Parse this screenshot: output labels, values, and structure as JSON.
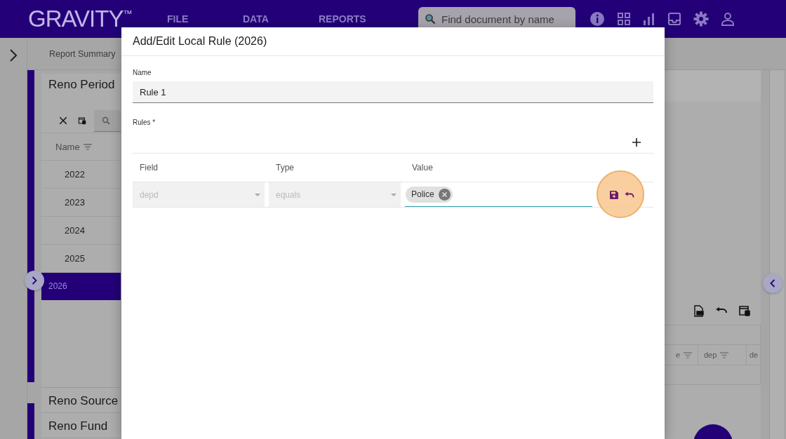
{
  "app": {
    "logo": "GRAVITY",
    "logo_mark": "™",
    "menu": [
      {
        "label": "FILE"
      },
      {
        "label": "DATA"
      },
      {
        "label": "REPORTS"
      }
    ],
    "search": {
      "placeholder": "Find document by name"
    }
  },
  "breadcrumb": "Report Summary",
  "left_panel": {
    "title": "Reno Period",
    "column": "Name",
    "rows": [
      {
        "label": "2022",
        "selected": false
      },
      {
        "label": "2023",
        "selected": false
      },
      {
        "label": "2024",
        "selected": false
      },
      {
        "label": "2025",
        "selected": false
      },
      {
        "label": "2026",
        "selected": true
      }
    ],
    "sections": [
      "Reno Source",
      "Reno Fund"
    ]
  },
  "right_panel": {
    "columns": [
      "e",
      "dep",
      "de"
    ]
  },
  "dialog": {
    "title": "Add/Edit Local Rule (2026)",
    "name_field": {
      "label": "Name",
      "value": "Rule 1"
    },
    "rules_label": "Rules *",
    "columns": [
      "Field",
      "Type",
      "Value"
    ],
    "rule": {
      "field": "depd",
      "type": "equals",
      "disabled": true,
      "chips": [
        "Police"
      ]
    }
  }
}
